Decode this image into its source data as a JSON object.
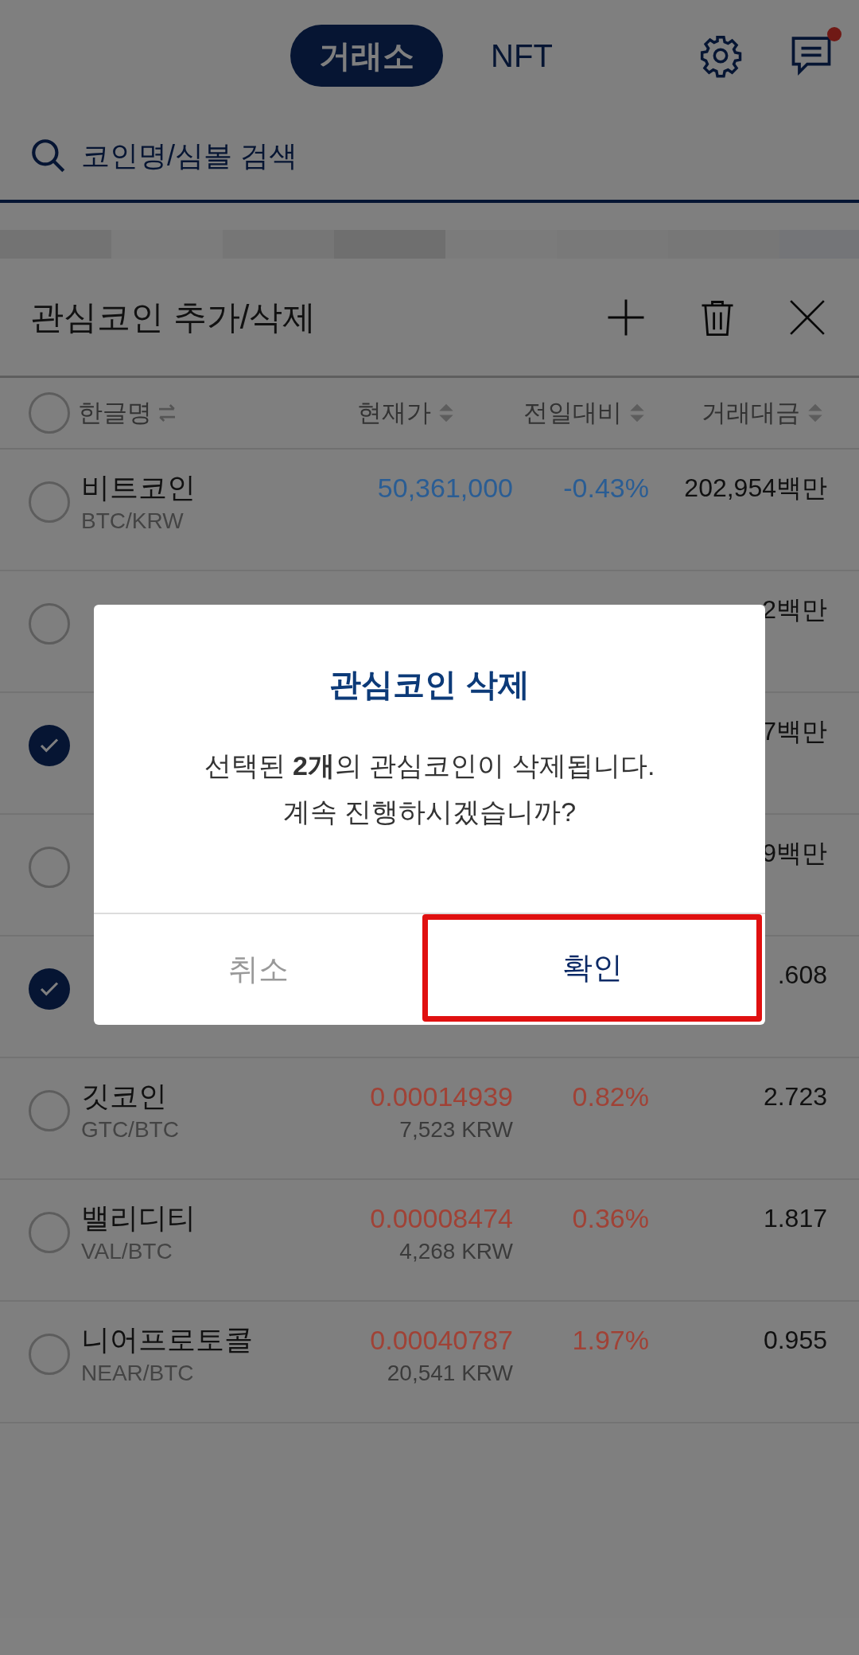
{
  "header": {
    "tabs": [
      {
        "label": "거래소",
        "selected": true
      },
      {
        "label": "NFT",
        "selected": false
      }
    ],
    "chat_notification": true
  },
  "search": {
    "placeholder": "코인명/심볼 검색"
  },
  "panel": {
    "title": "관심코인 추가/삭제"
  },
  "columns": [
    {
      "label": "한글명",
      "kind": "swap"
    },
    {
      "label": "현재가",
      "kind": "sort"
    },
    {
      "label": "전일대비",
      "kind": "sort"
    },
    {
      "label": "거래대금",
      "kind": "sort"
    }
  ],
  "select_all": {
    "checked": false
  },
  "rows": [
    {
      "checked": false,
      "name": "비트코인",
      "pair": "BTC/KRW",
      "price": "50,361,000",
      "change": "-0.43%",
      "color": "#2a5d94",
      "volume": "202,954백만"
    },
    {
      "checked": false,
      "volume": "2백만"
    },
    {
      "checked": true,
      "volume": "7백만"
    },
    {
      "checked": false,
      "volume": "9백만"
    },
    {
      "checked": true,
      "volume": ".608"
    },
    {
      "checked": false,
      "name": "깃코인",
      "pair": "GTC/BTC",
      "price": "0.00014939",
      "krw": "7,523 KRW",
      "change": "0.82%",
      "color": "#a04236",
      "volume": "2.723"
    },
    {
      "checked": false,
      "name": "밸리디티",
      "pair": "VAL/BTC",
      "price": "0.00008474",
      "krw": "4,268 KRW",
      "change": "0.36%",
      "color": "#a04236",
      "volume": "1.817"
    },
    {
      "checked": false,
      "name": "니어프로토콜",
      "pair": "NEAR/BTC",
      "price": "0.00040787",
      "krw": "20,541 KRW",
      "change": "1.97%",
      "color": "#a04236",
      "volume": "0.955"
    }
  ],
  "dialog": {
    "title": "관심코인 삭제",
    "message_lines": [
      "선택된 **2개**의 관심코인이 삭제됩니다.",
      "계속 진행하시겠습니까?"
    ],
    "buttons": [
      {
        "label": "취소",
        "kind": "cancel",
        "highlighted": false
      },
      {
        "label": "확인",
        "kind": "confirm",
        "highlighted": true
      }
    ]
  }
}
